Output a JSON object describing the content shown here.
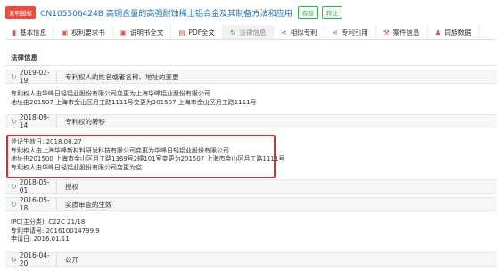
{
  "header": {
    "status_badge": "发明授权",
    "title": "CN105506424B 高铜含量的高强耐蚀稀土铝合金及其制备方法和应用",
    "tags": [
      "有权",
      "转让"
    ]
  },
  "tabs": [
    {
      "label": "基本信息",
      "icon": "bookmark-icon",
      "color": "#d9534f"
    },
    {
      "label": "权利要求书",
      "icon": "document-icon",
      "color": "#d9534f"
    },
    {
      "label": "说明书全文",
      "icon": "document-icon",
      "color": "#d9534f"
    },
    {
      "label": "PDF全文",
      "icon": "pdf-icon",
      "color": "#d9534f"
    },
    {
      "label": "法律信息",
      "icon": "refresh-icon",
      "color": "#3aa655"
    },
    {
      "label": "相似专利",
      "icon": "share-icon",
      "color": "#3a7bd5"
    },
    {
      "label": "专利引用",
      "icon": "share-icon",
      "color": "#3a7bd5"
    },
    {
      "label": "案件信息",
      "icon": "gavel-icon",
      "color": "#d9534f"
    },
    {
      "label": "同族数据",
      "icon": "family-icon",
      "color": "#d9534f"
    }
  ],
  "active_tab": "法律信息",
  "section_title": "法律信息",
  "events": [
    {
      "date": "2019-02-19",
      "type": "专利权人的姓名或者名称、地址的变更"
    },
    {
      "date": "2018-09-14",
      "type": "专利权的转移"
    },
    {
      "date": "2018-05-01",
      "type": "授权"
    },
    {
      "date": "2016-05-18",
      "type": "实质审查的生效"
    },
    {
      "date": "2016-04-20",
      "type": "公开"
    }
  ],
  "details": {
    "change_2019": [
      "专利权人由华峰日轻铝业股份有限公司变更为上海华峰铝业股份有限公司",
      "地址由201507 上海市金山区月工路1111号变更为201507 上海市金山区月工路1111号"
    ],
    "transfer_2018": [
      "登记生效日: 2018.08.27",
      "专利权人由上海华峰新材料研发科技有限公司变更为华峰日轻铝业股份有限公司",
      "地址由201500 上海市金山区月工路1369号2幢101室变更为201507 上海市金山区月工路1111号",
      "专利权人由华峰日轻铝业股份有限公司变更为空"
    ],
    "exam_2016": [
      "IPC(主分类): C22C 21/18",
      "专利申请号: 201610014799.9",
      "申请日: 2016.01.11"
    ]
  }
}
